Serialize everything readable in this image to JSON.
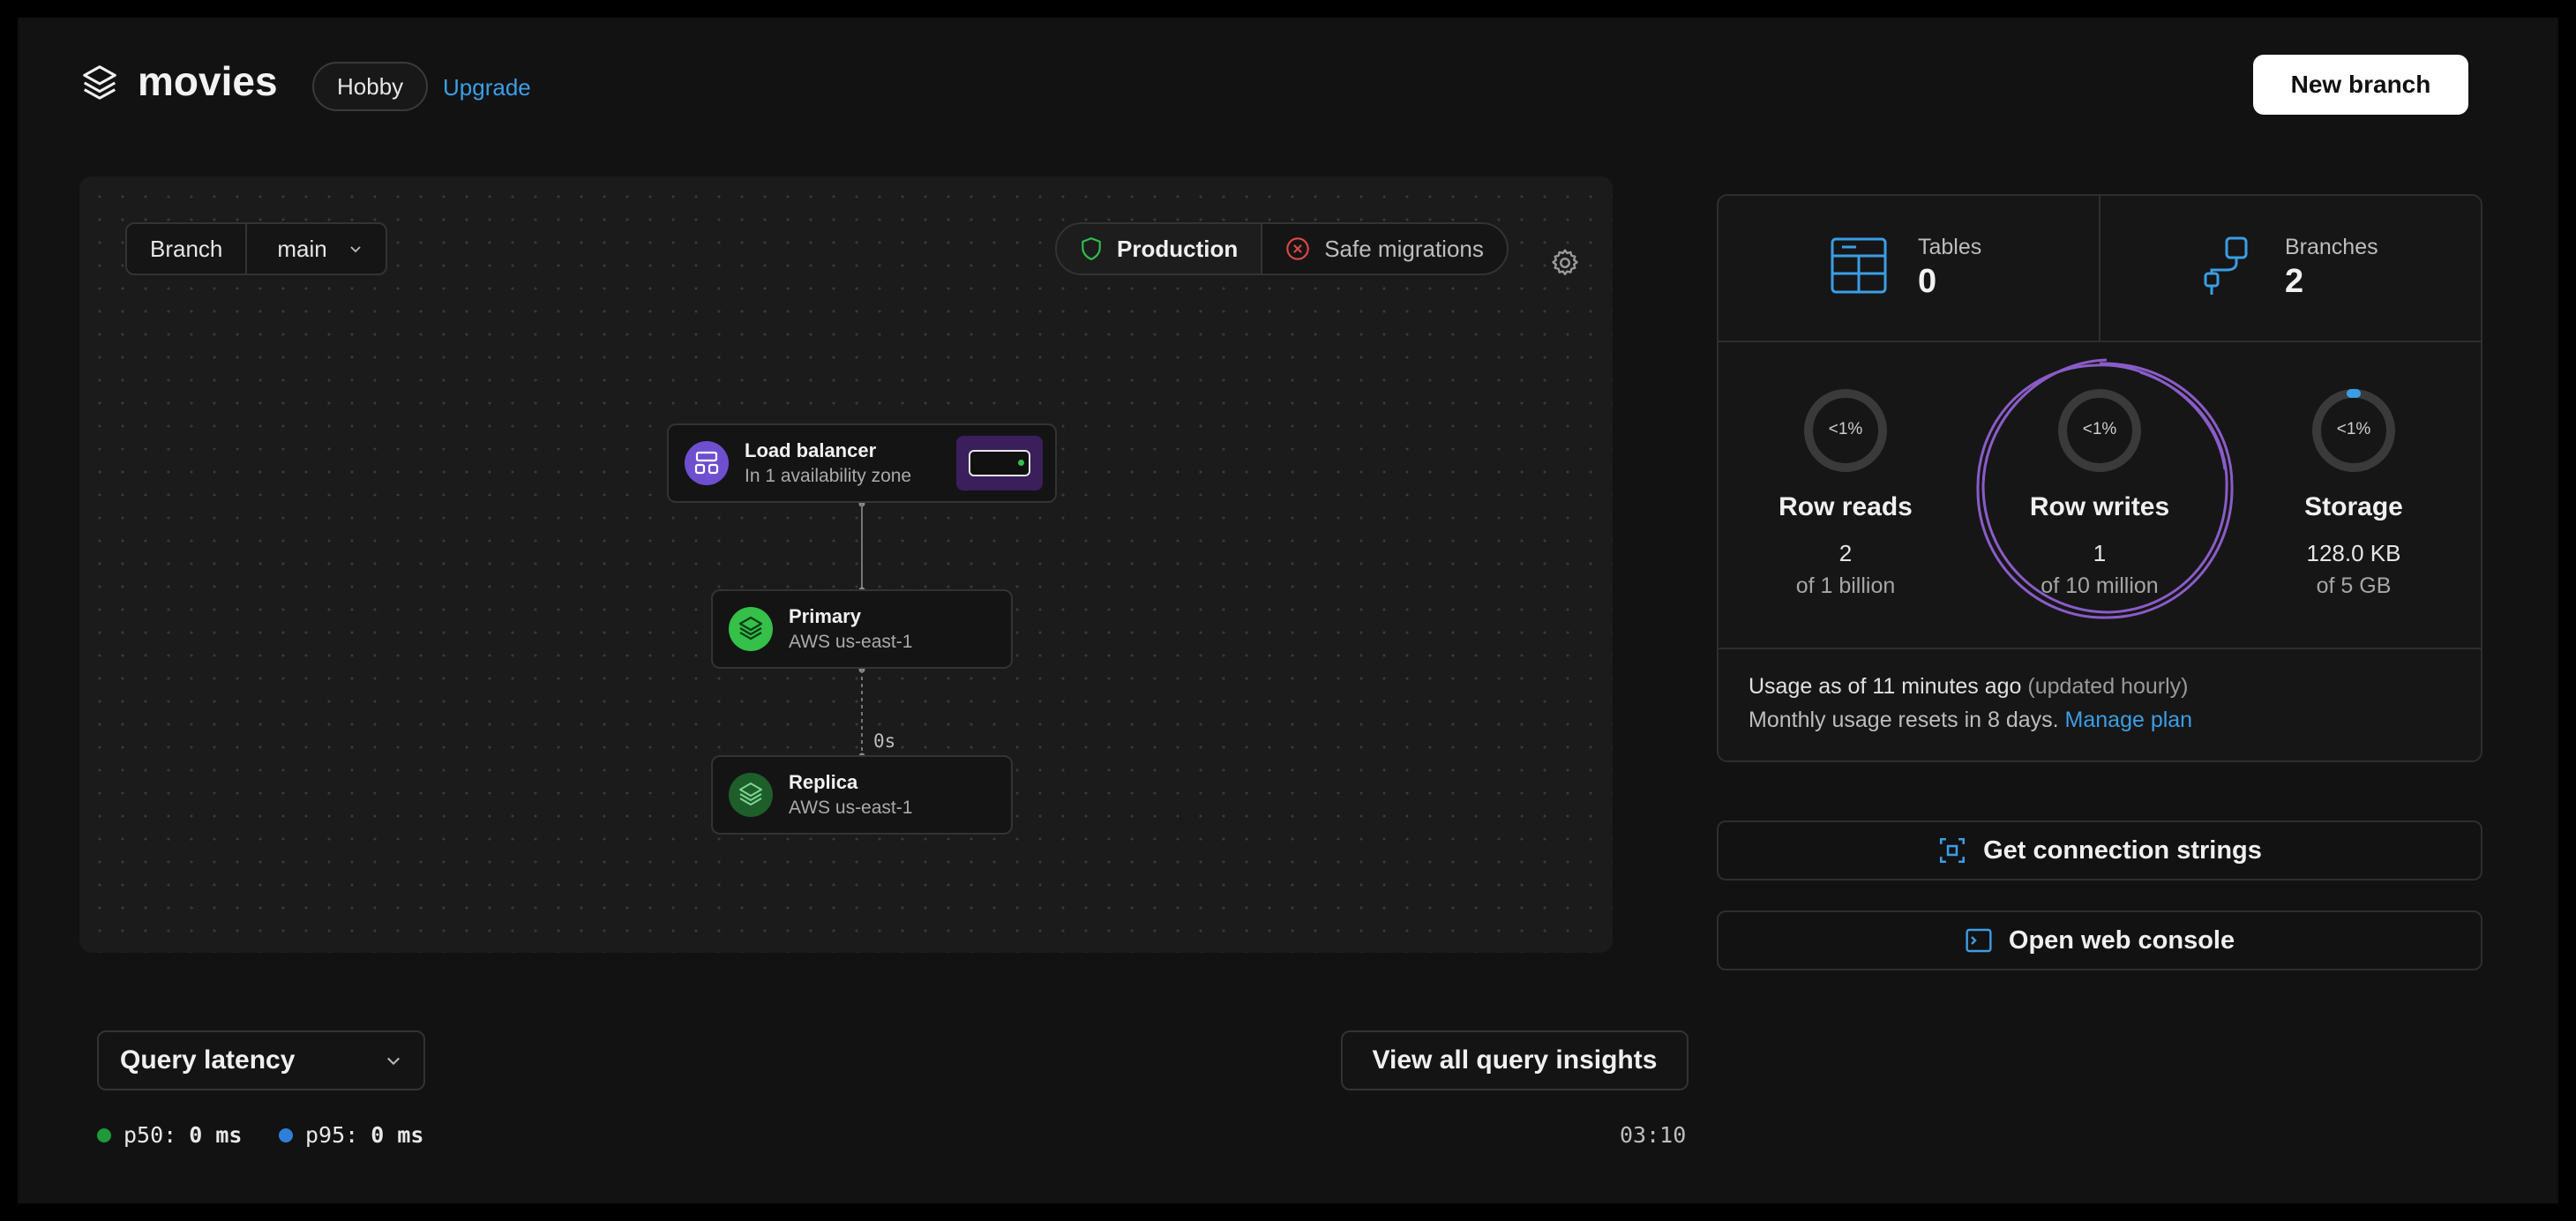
{
  "header": {
    "app_title": "movies",
    "plan_badge": "Hobby",
    "upgrade_label": "Upgrade",
    "new_branch_label": "New branch"
  },
  "canvas": {
    "branch_label": "Branch",
    "branch_value": "main",
    "production_label": "Production",
    "safe_migrations_label": "Safe migrations",
    "nodes": {
      "load_balancer": {
        "title": "Load balancer",
        "subtitle": "In 1 availability zone"
      },
      "primary": {
        "title": "Primary",
        "subtitle": "AWS us-east-1"
      },
      "replica": {
        "title": "Replica",
        "subtitle": "AWS us-east-1"
      }
    },
    "replication_lag": "0s"
  },
  "stats": {
    "tables": {
      "label": "Tables",
      "value": "0"
    },
    "branches": {
      "label": "Branches",
      "value": "2"
    },
    "metrics": [
      {
        "title": "Row reads",
        "percent": "<1%",
        "value": "2",
        "limit": "of 1 billion"
      },
      {
        "title": "Row writes",
        "percent": "<1%",
        "value": "1",
        "limit": "of 10 million"
      },
      {
        "title": "Storage",
        "percent": "<1%",
        "value": "128.0 KB",
        "limit": "of 5 GB"
      }
    ],
    "usage_line": "Usage as of 11 minutes ago",
    "usage_updated": "(updated hourly)",
    "reset_line": "Monthly usage resets in 8 days.",
    "manage_plan_label": "Manage plan"
  },
  "actions": {
    "connection_strings_label": "Get connection strings",
    "web_console_label": "Open web console"
  },
  "latency": {
    "selector_label": "Query latency",
    "insights_label": "View all query insights",
    "p50_label": "p50:",
    "p50_value": "0 ms",
    "p95_label": "p95:",
    "p95_value": "0 ms",
    "timestamp": "03:10"
  },
  "colors": {
    "accent_blue": "#3b9ee5",
    "primary_green": "#35c04a",
    "load_balancer_purple": "#6e4fd0",
    "annotation_purple": "#8a5cc8",
    "p50_green": "#1f9a3a",
    "p95_blue": "#2f7fd8"
  }
}
